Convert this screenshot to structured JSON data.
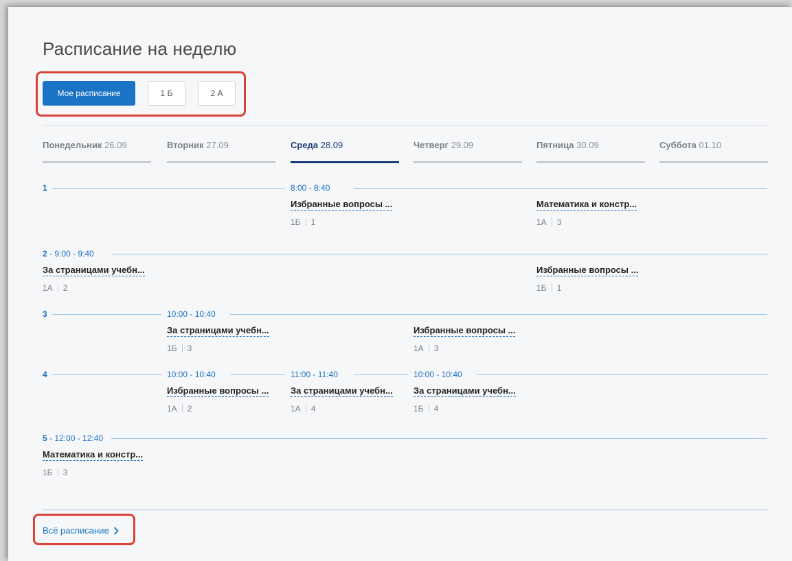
{
  "title": "Расписание на неделю",
  "filters": [
    {
      "label": "Мое расписание",
      "active": true
    },
    {
      "label": "1 Б",
      "active": false
    },
    {
      "label": "2 А",
      "active": false
    }
  ],
  "days": [
    {
      "name": "Понедельник",
      "date": "26.09",
      "active": false
    },
    {
      "name": "Вторник",
      "date": "27.09",
      "active": false
    },
    {
      "name": "Среда",
      "date": "28.09",
      "active": true
    },
    {
      "name": "Четверг",
      "date": "29.09",
      "active": false
    },
    {
      "name": "Пятница",
      "date": "30.09",
      "active": false
    },
    {
      "name": "Суббота",
      "date": "01.10",
      "active": false
    }
  ],
  "rows": [
    {
      "number": "1",
      "time": "",
      "lessons": [
        {
          "day": 2,
          "time": "8:00 - 8:40",
          "subject": "Избранные вопросы ...",
          "class": "1Б",
          "room": "1"
        },
        {
          "day": 4,
          "time": "",
          "subject": "Математика и констр...",
          "class": "1А",
          "room": "3"
        }
      ]
    },
    {
      "number": "2",
      "time": "9:00 - 9:40",
      "lessons": [
        {
          "day": 0,
          "time": "",
          "subject": "За страницами учебн...",
          "class": "1А",
          "room": "2"
        },
        {
          "day": 4,
          "time": "",
          "subject": "Избранные вопросы ...",
          "class": "1Б",
          "room": "1"
        }
      ]
    },
    {
      "number": "3",
      "time": "",
      "lessons": [
        {
          "day": 1,
          "time": "10:00 - 10:40",
          "subject": "За страницами учебн...",
          "class": "1Б",
          "room": "3"
        },
        {
          "day": 3,
          "time": "",
          "subject": "Избранные вопросы ...",
          "class": "1А",
          "room": "3"
        }
      ]
    },
    {
      "number": "4",
      "time": "",
      "lessons": [
        {
          "day": 1,
          "time": "10:00 - 10:40",
          "subject": "Избранные вопросы ...",
          "class": "1А",
          "room": "2"
        },
        {
          "day": 2,
          "time": "11:00 - 11:40",
          "subject": "За страницами учебн...",
          "class": "1А",
          "room": "4"
        },
        {
          "day": 3,
          "time": "10:00 - 10:40",
          "subject": "За страницами учебн...",
          "class": "1Б",
          "room": "4"
        }
      ]
    },
    {
      "number": "5",
      "time": "12:00 - 12:40",
      "lessons": [
        {
          "day": 0,
          "time": "",
          "subject": "Математика и констр...",
          "class": "1Б",
          "room": "3"
        }
      ]
    }
  ],
  "all_schedule_link": "Всё расписание",
  "colors": {
    "accent": "#1a73c6",
    "active_day": "#1d3d7a",
    "highlight": "#d9413a"
  }
}
